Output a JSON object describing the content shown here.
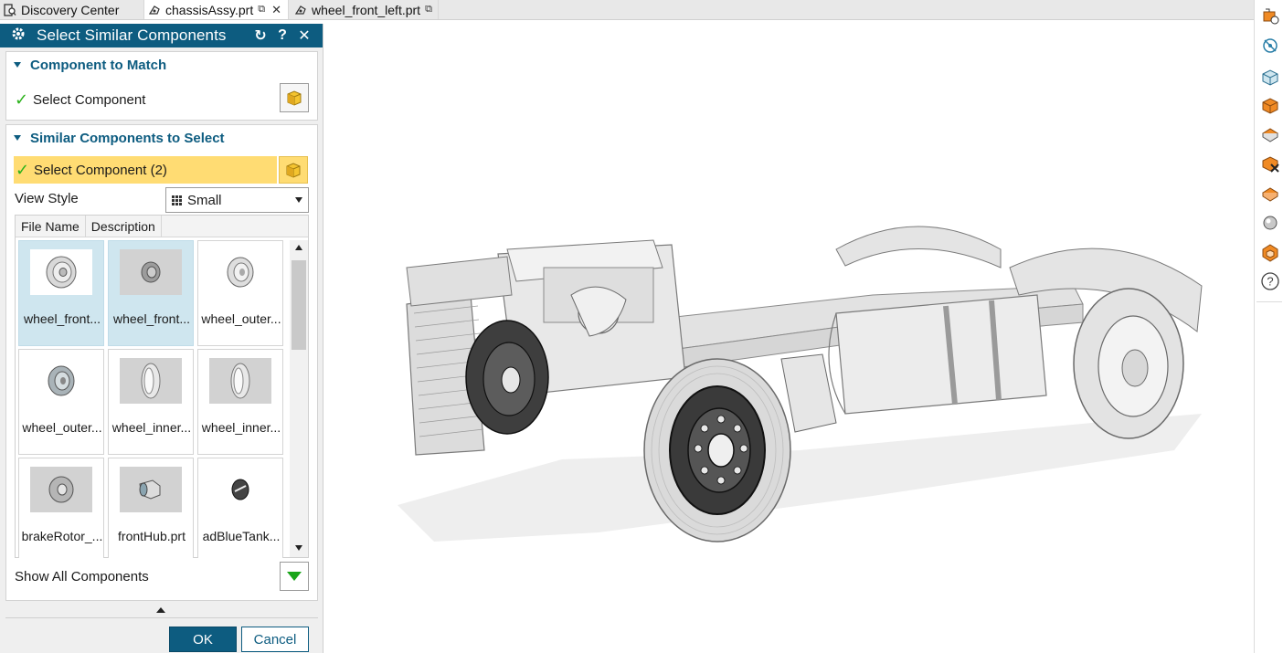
{
  "tabs": [
    {
      "label": "Discovery Center",
      "icon": "discovery-center-icon"
    },
    {
      "label": "chassisAssy.prt",
      "icon": "part-icon",
      "active": true
    },
    {
      "label": "wheel_front_left.prt",
      "icon": "part-icon"
    }
  ],
  "dialog": {
    "title": "Select Similar Components",
    "header_icons": [
      "gear-icon",
      "reset-icon",
      "help-icon",
      "close-icon"
    ],
    "help_glyph": "?",
    "close_glyph": "✕",
    "reset_glyph": "↻",
    "component_to_match": {
      "heading": "Component to Match",
      "select_label": "Select Component"
    },
    "similar_components": {
      "heading": "Similar Components to Select",
      "select_label": "Select Component (2)",
      "view_style_label": "View Style",
      "view_style_value": "Small",
      "columns": [
        "File Name",
        "Description"
      ],
      "items": [
        {
          "label": "wheel_front...",
          "selected": true,
          "thumb": "wheel"
        },
        {
          "label": "wheel_front...",
          "selected": true,
          "thumb": "wheel-small"
        },
        {
          "label": "wheel_outer...",
          "selected": false,
          "thumb": "wheel-outer"
        },
        {
          "label": "wheel_outer...",
          "selected": false,
          "thumb": "wheel-outer-2"
        },
        {
          "label": "wheel_inner...",
          "selected": false,
          "thumb": "rim"
        },
        {
          "label": "wheel_inner...",
          "selected": false,
          "thumb": "rim"
        },
        {
          "label": "brakeRotor_...",
          "selected": false,
          "thumb": "rotor"
        },
        {
          "label": "frontHub.prt",
          "selected": false,
          "thumb": "hub"
        },
        {
          "label": "adBlueTank...",
          "selected": false,
          "thumb": "tank"
        }
      ],
      "show_all_label": "Show All Components"
    },
    "ok_label": "OK",
    "cancel_label": "Cancel"
  },
  "colors": {
    "header_blue": "#0d5c80",
    "highlight_yellow": "#ffdc73",
    "selected_thumb": "#cfe6ef",
    "check_green": "#2bb21b",
    "orange_tool": "#f08a24"
  },
  "right_toolbar": [
    "assembly-navigator-icon",
    "constraint-navigator-icon",
    "part-navigator-icon",
    "reuse-library-icon",
    "hd3d-tools-icon",
    "role-icon",
    "history-icon",
    "system-materials-icon",
    "process-studio-icon",
    "help-circle-icon"
  ]
}
